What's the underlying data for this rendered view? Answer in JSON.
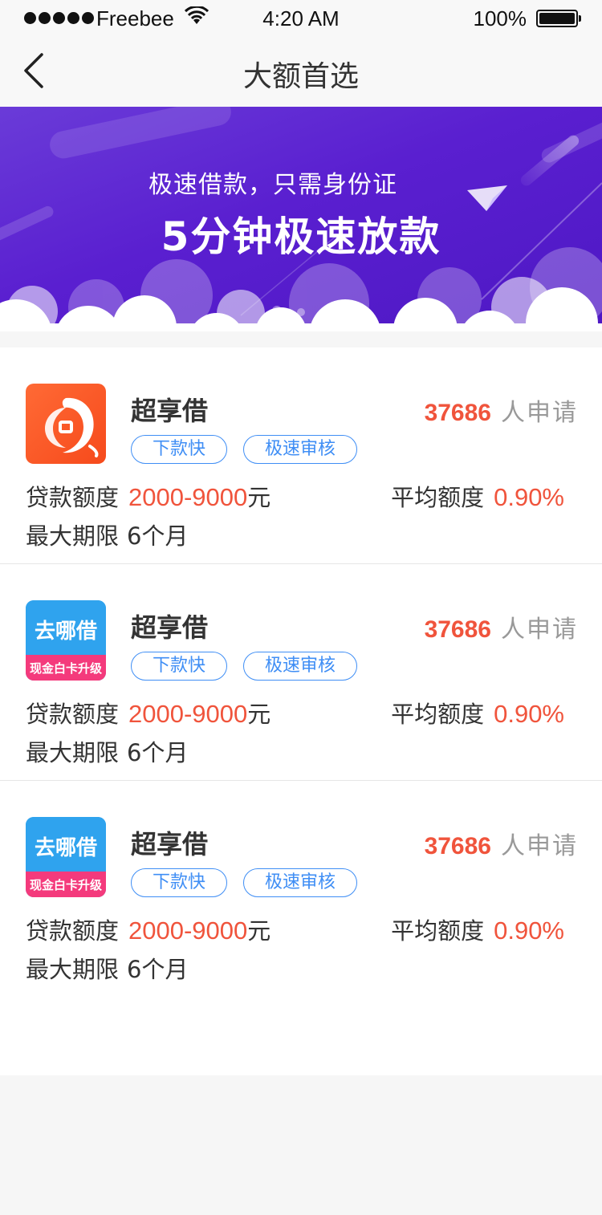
{
  "status_bar": {
    "carrier": "Freebee",
    "time": "4:20 AM",
    "battery": "100%"
  },
  "nav": {
    "title": "大额首选"
  },
  "banner": {
    "line1": "极速借款，只需身份证",
    "line2": "5分钟极速放款"
  },
  "loans": [
    {
      "name": "超享借",
      "count": "37686",
      "count_suffix": "人申请",
      "tags": [
        "下款快",
        "极速审核"
      ],
      "amount_label": "贷款额度",
      "amount_value": "2000-9000",
      "amount_unit": "元",
      "rate_label": "平均额度",
      "rate_value": "0.90%",
      "term_label": "最大期限",
      "term_value": "6个月",
      "logo_icon": "swirl-orange-logo"
    },
    {
      "name": "超享借",
      "count": "37686",
      "count_suffix": "人申请",
      "tags": [
        "下款快",
        "极速审核"
      ],
      "amount_label": "贷款额度",
      "amount_value": "2000-9000",
      "amount_unit": "元",
      "rate_label": "平均额度",
      "rate_value": "0.90%",
      "term_label": "最大期限",
      "term_value": "6个月",
      "logo_icon": "qunajie-logo",
      "logo_text_top": "去哪借",
      "logo_text_bottom": "现金白卡升级"
    },
    {
      "name": "超享借",
      "count": "37686",
      "count_suffix": "人申请",
      "tags": [
        "下款快",
        "极速审核"
      ],
      "amount_label": "贷款额度",
      "amount_value": "2000-9000",
      "amount_unit": "元",
      "rate_label": "平均额度",
      "rate_value": "0.90%",
      "term_label": "最大期限",
      "term_value": "6个月",
      "logo_icon": "qunajie-logo",
      "logo_text_top": "去哪借",
      "logo_text_bottom": "现金白卡升级"
    }
  ],
  "colors": {
    "accent_red": "#f0543c",
    "tag_blue": "#3f8ef5",
    "banner_purple": "#5a1fd0"
  }
}
